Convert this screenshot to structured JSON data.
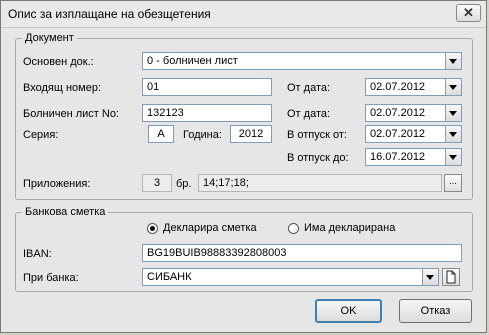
{
  "window": {
    "title": "Опис за изплащане на обезщетения",
    "close_glyph": "✕"
  },
  "document_group": {
    "legend": "Документ",
    "basic_doc_label": "Основен док.:",
    "basic_doc_value": "0 - болничен лист",
    "incoming_no_label": "Входящ номер:",
    "incoming_no_value": "01",
    "from_date_label_1": "От дата:",
    "from_date_value_1": "02.07.2012",
    "sick_leave_label": "Болничен лист No:",
    "sick_leave_value": "132123",
    "from_date_label_2": "От дата:",
    "from_date_value_2": "02.07.2012",
    "series_label": "Серия:",
    "series_value": "А",
    "year_label": "Година:",
    "year_value": "2012",
    "leave_from_label": "В отпуск от:",
    "leave_from_value": "02.07.2012",
    "leave_to_label": "В отпуск до:",
    "leave_to_value": "16.07.2012",
    "attachments_label": "Приложения:",
    "attachments_count": "3",
    "attachments_unit": "бр.",
    "attachments_list": "14;17;18;",
    "ellipsis_glyph": "..."
  },
  "bank_group": {
    "legend": "Банкова сметка",
    "radio_declares": "Декларира сметка",
    "radio_declared": "Има декларирана",
    "radio_selected": "declares",
    "iban_label": "IBAN:",
    "iban_value": "BG19BUIB98883392808003",
    "bank_label": "При банка:",
    "bank_value": "СИБАНК"
  },
  "buttons": {
    "ok": "OK",
    "cancel": "Отказ"
  }
}
